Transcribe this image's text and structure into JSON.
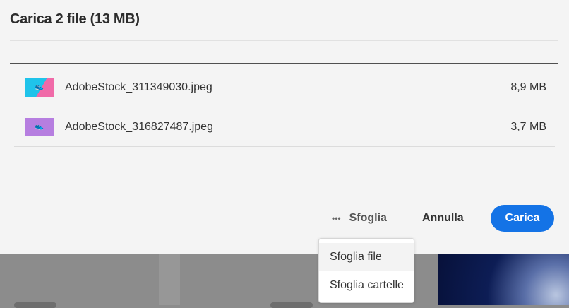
{
  "dialog": {
    "title": "Carica 2 file (13 MB)"
  },
  "files": [
    {
      "name": "AdobeStock_311349030.jpeg",
      "size": "8,9 MB",
      "thumb_colors": [
        "#1fc3ea",
        "#f06aa8"
      ]
    },
    {
      "name": "AdobeStock_316827487.jpeg",
      "size": "3,7 MB",
      "thumb_colors": [
        "#b67ee0",
        "#b67ee0"
      ]
    }
  ],
  "actions": {
    "more_icon": "•••",
    "browse": "Sfoglia",
    "cancel": "Annulla",
    "upload": "Carica"
  },
  "browse_menu": {
    "items": [
      "Sfoglia file",
      "Sfoglia cartelle"
    ]
  },
  "colors": {
    "accent": "#1473e6"
  }
}
